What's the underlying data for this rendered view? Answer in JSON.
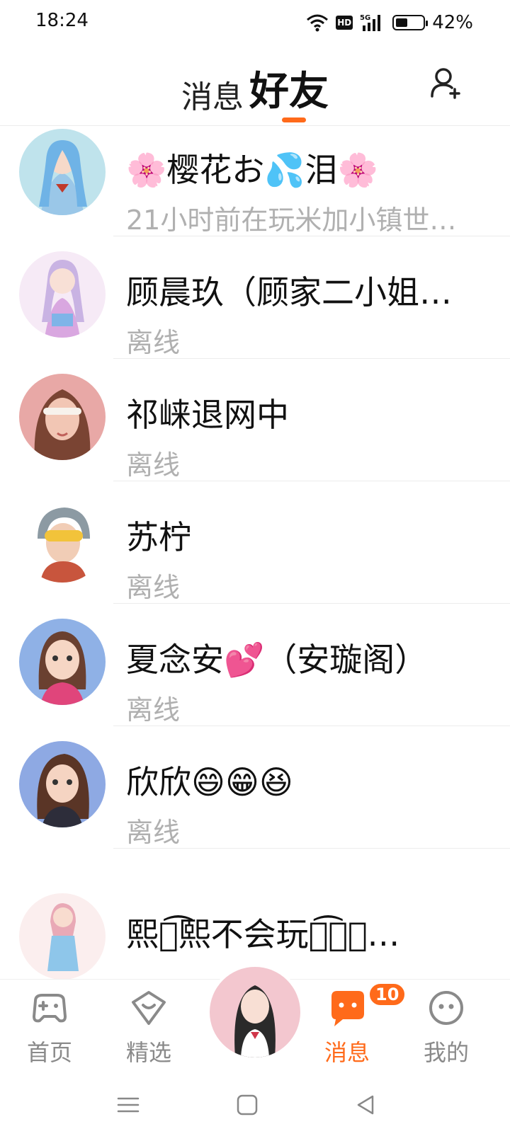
{
  "status_bar": {
    "time": "18:24",
    "network": "5G",
    "hd": "HD",
    "battery_percent": "42%",
    "battery_level": 0.42
  },
  "header": {
    "tabs": [
      {
        "label": "消息",
        "active": false
      },
      {
        "label": "好友",
        "active": true
      }
    ],
    "add_friend_icon": "add-person-icon",
    "accent_color": "#ff6a1a"
  },
  "friends": [
    {
      "name": "🌸樱花お💦泪🌸",
      "status": "21小时前在玩米加小镇世…"
    },
    {
      "name": "顾晨玖（顾家二小姐…",
      "status": "离线"
    },
    {
      "name": "祁崃退网中",
      "status": "离线"
    },
    {
      "name": "苏柠",
      "status": "离线"
    },
    {
      "name": "夏念安💕（安璇阁）",
      "status": "离线"
    },
    {
      "name": "欣欣😄😁😆",
      "status": "离线"
    },
    {
      "name": "熙ꦿ͡熙不会玩ꦿ͡𝓜ꦼ…",
      "status": ""
    }
  ],
  "bottom_nav": {
    "items": [
      {
        "label": "首页",
        "icon": "gamepad-icon",
        "active": false
      },
      {
        "label": "精选",
        "icon": "heart-shield-icon",
        "active": false
      },
      {
        "label": "消息",
        "icon": "chat-bubble-icon",
        "active": true,
        "badge": "10"
      },
      {
        "label": "我的",
        "icon": "smiley-face-icon",
        "active": false
      }
    ]
  },
  "system_nav": {
    "items": [
      "menu-icon",
      "home-square-icon",
      "back-triangle-icon"
    ]
  }
}
